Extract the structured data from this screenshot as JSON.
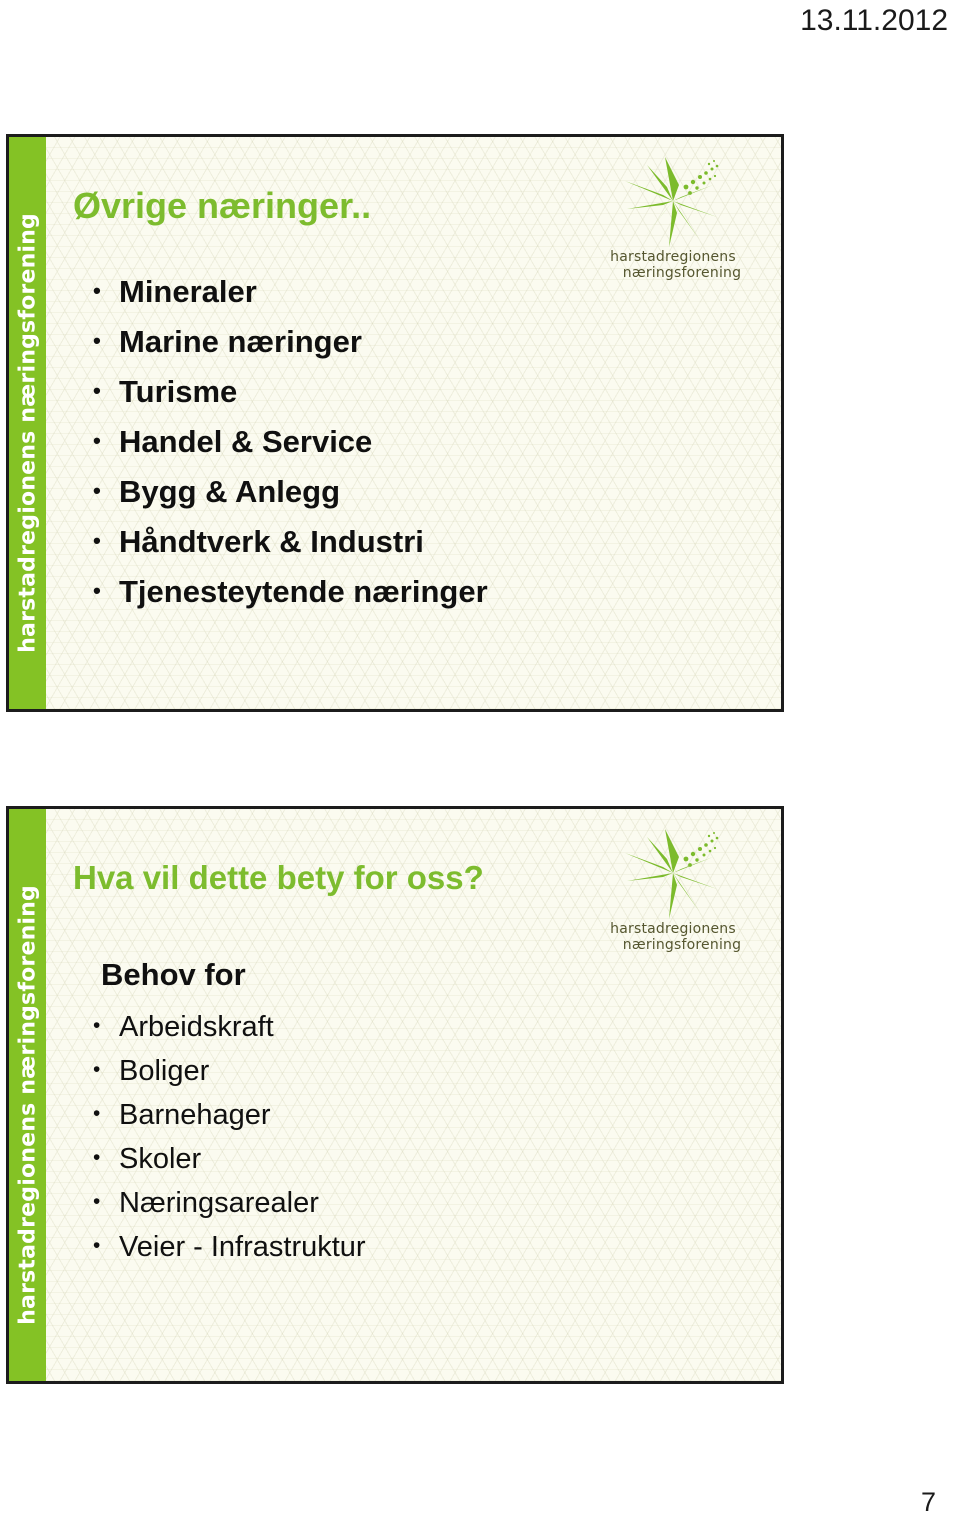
{
  "header": {
    "date": "13.11.2012"
  },
  "footer": {
    "page_number": "7"
  },
  "colors": {
    "brand_green": "#84c225",
    "title_green": "#7dbc2e",
    "slide_background": "#fbfbf0",
    "slide_border": "#1c1c1c",
    "body_text": "#101010",
    "logo_text": "#55562f"
  },
  "logo": {
    "mark_name": "starburst-logo-mark",
    "line1": "harstadregionens",
    "line2": "næringsforening"
  },
  "sidebar": {
    "label": "harstadregionens næringsforening"
  },
  "slides": [
    {
      "id": "slide-1",
      "title": "Øvrige næringer..",
      "subhead": "",
      "bullets": [
        "Mineraler",
        "Marine næringer",
        "Turisme",
        "Handel & Service",
        "Bygg & Anlegg",
        "Håndtverk & Industri",
        "Tjenesteytende næringer"
      ]
    },
    {
      "id": "slide-2",
      "title": "Hva vil dette bety for oss?",
      "subhead": "Behov for",
      "bullets": [
        "Arbeidskraft",
        "Boliger",
        "Barnehager",
        "Skoler",
        "Næringsarealer",
        "Veier - Infrastruktur"
      ]
    }
  ]
}
